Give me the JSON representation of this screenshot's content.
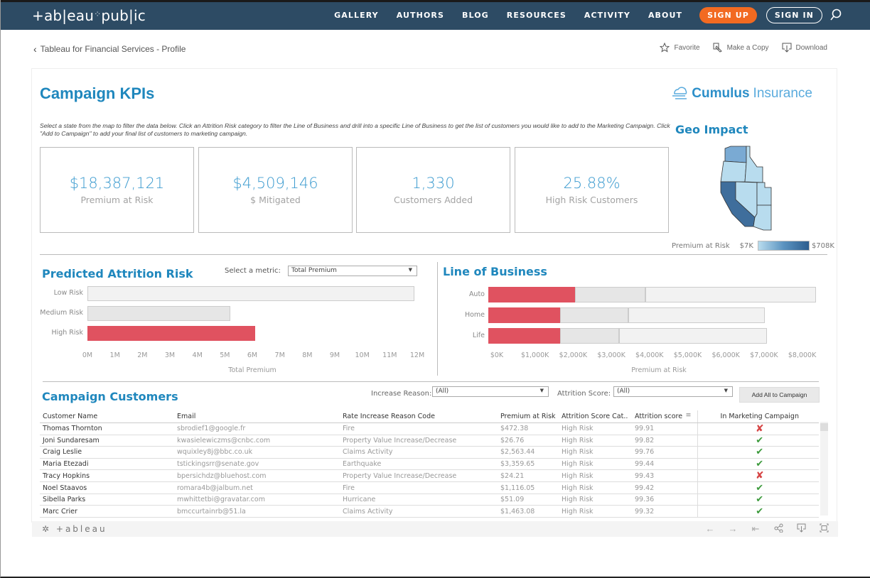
{
  "topnav": {
    "logo": "+ab|eau",
    "logo_dots": "⁘",
    "logo_suffix": "pub|ic",
    "links": [
      "GALLERY",
      "AUTHORS",
      "BLOG",
      "RESOURCES",
      "ACTIVITY",
      "ABOUT"
    ],
    "signup": "SIGN UP",
    "signin": "SIGN IN",
    "accent": "#f26a21",
    "bg": "#2d4b64"
  },
  "subheader": {
    "back_label": "Tableau for Financial Services - Profile",
    "favorite": "Favorite",
    "make_copy": "Make a Copy",
    "download": "Download"
  },
  "dashboard": {
    "title": "Campaign KPIs",
    "brand_bold": "Cumulus",
    "brand_light": "Insurance",
    "instructions": "Select a state from the map to filter the data below. Click an Attrition Risk category to filter the Line of Business and drill into a specific Line of Business to get the list of customers you would like to add to the Marketing Campaign. Click \"Add to Campaign\" to add your final list of customers to marketing campaign.",
    "kpis": [
      {
        "value": "$18,387,121",
        "label": "Premium at Risk"
      },
      {
        "value": "$4,509,146",
        "label": "$ Mitigated"
      },
      {
        "value": "1,330",
        "label": "Customers Added"
      },
      {
        "value": "25.88%",
        "label": "High Risk Customers"
      }
    ],
    "geo": {
      "title": "Geo Impact",
      "legend_label": "Premium at Risk",
      "legend_min": "$7K",
      "legend_max": "$708K"
    },
    "attrition": {
      "title": "Predicted Attrition Risk",
      "metric_label": "Select a metric:",
      "metric_value": "Total Premium"
    },
    "lob": {
      "title": "Line of Business"
    },
    "customers": {
      "title": "Campaign Customers",
      "increase_reason_label": "Increase Reason:",
      "increase_reason_value": "(All)",
      "attrition_score_label": "Attrition Score:",
      "attrition_score_value": "(All)",
      "add_all_button": "Add All to Campaign",
      "columns": [
        "Customer Name",
        "Email",
        "Rate Increase Reason Code",
        "Premium at Risk",
        "Attrition Score Cat..",
        "Attrition score",
        "In Marketing Campaign"
      ],
      "rows": [
        {
          "name": "Thomas Thornton",
          "email": "sbrodief1@google.fr",
          "reason": "Fire",
          "premium": "$472.38",
          "category": "High Risk",
          "score": "99.91",
          "in_campaign": false
        },
        {
          "name": "Joni Sundaresam",
          "email": "kwasielewiczms@cnbc.com",
          "reason": "Property Value Increase/Decrease",
          "premium": "$26.76",
          "category": "High Risk",
          "score": "99.82",
          "in_campaign": true
        },
        {
          "name": "Craig Leslie",
          "email": "wquixley8j@bbc.co.uk",
          "reason": "Claims Activity",
          "premium": "$2,563.44",
          "category": "High Risk",
          "score": "99.76",
          "in_campaign": true
        },
        {
          "name": "Maria Etezadi",
          "email": "tstickingsrr@senate.gov",
          "reason": "Earthquake",
          "premium": "$3,359.65",
          "category": "High Risk",
          "score": "99.44",
          "in_campaign": true
        },
        {
          "name": "Tracy Hopkins",
          "email": "bpersichdz@bluehost.com",
          "reason": "Property Value Increase/Decrease",
          "premium": "$24.21",
          "category": "High Risk",
          "score": "99.43",
          "in_campaign": false
        },
        {
          "name": "Noel Staavos",
          "email": "romara4b@jalbum.net",
          "reason": "Fire",
          "premium": "$1,116.05",
          "category": "High Risk",
          "score": "99.42",
          "in_campaign": true
        },
        {
          "name": "Sibella Parks",
          "email": "mwhittetbi@gravatar.com",
          "reason": "Hurricane",
          "premium": "$51.09",
          "category": "High Risk",
          "score": "99.36",
          "in_campaign": true
        },
        {
          "name": "Marc Crier",
          "email": "bmccurtainrb@51.la",
          "reason": "Claims Activity",
          "premium": "$1,463.08",
          "category": "High Risk",
          "score": "99.32",
          "in_campaign": true
        }
      ]
    },
    "footer": {
      "logo": "+ableau",
      "controls": [
        "undo-icon",
        "redo-icon",
        "revert-icon",
        "share-icon",
        "download-icon",
        "fullscreen-icon"
      ]
    }
  },
  "chart_data": [
    {
      "type": "bar",
      "title": "Predicted Attrition Risk",
      "categories": [
        "Low Risk",
        "Medium Risk",
        "High Risk"
      ],
      "values": [
        11.9,
        5.2,
        6.1
      ],
      "unit": "M",
      "colors": [
        "#f2f2f2",
        "#e6e6e6",
        "#e05260"
      ],
      "xlabel": "Total Premium",
      "ylabel": "",
      "xlim": [
        0,
        12
      ],
      "ticks": [
        "0M",
        "1M",
        "2M",
        "3M",
        "4M",
        "5M",
        "6M",
        "7M",
        "8M",
        "9M",
        "10M",
        "11M",
        "12M"
      ]
    },
    {
      "type": "bar",
      "stacked": true,
      "title": "Line of Business",
      "categories": [
        "Auto",
        "Home",
        "Life"
      ],
      "series": [
        {
          "name": "High Risk",
          "color": "#e05260",
          "values": [
            2280,
            1890,
            1890
          ]
        },
        {
          "name": "Medium Risk",
          "color": "#e6e6e6",
          "values": [
            1850,
            1790,
            1560
          ]
        },
        {
          "name": "Low Risk",
          "color": "#f2f2f2",
          "values": [
            4500,
            3600,
            3880
          ]
        }
      ],
      "unit": "K",
      "xlabel": "Premium at Risk",
      "xlim": [
        0,
        8630
      ],
      "ticks": [
        "$0K",
        "$1,000K",
        "$2,000K",
        "$3,000K",
        "$4,000K",
        "$5,000K",
        "$6,000K",
        "$7,000K",
        "$8,000K"
      ]
    }
  ]
}
